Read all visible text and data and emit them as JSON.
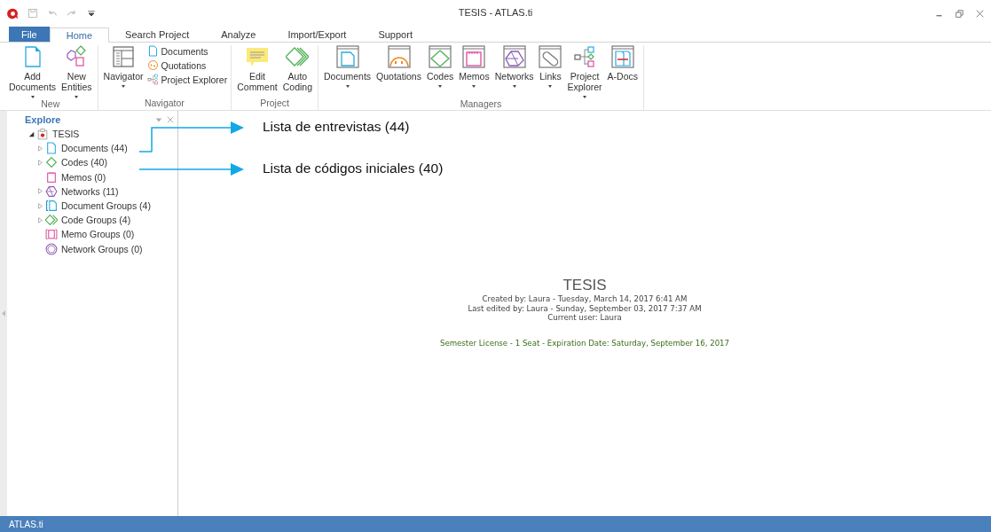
{
  "window": {
    "title": "TESIS - ATLAS.ti"
  },
  "tabs": [
    {
      "label": "File",
      "kind": "file",
      "selected": false
    },
    {
      "label": "Home",
      "kind": "tab",
      "selected": true
    },
    {
      "label": "Search Project",
      "kind": "tab",
      "selected": false
    },
    {
      "label": "Analyze",
      "kind": "tab",
      "selected": false
    },
    {
      "label": "Import/Export",
      "kind": "tab",
      "selected": false
    },
    {
      "label": "Support",
      "kind": "tab",
      "selected": false
    }
  ],
  "ribbon": {
    "groups": [
      {
        "label": "New",
        "buttons": [
          {
            "kind": "large",
            "lines": [
              "Add",
              "Documents"
            ],
            "dropdown": true
          },
          {
            "kind": "large",
            "lines": [
              "New",
              "Entities"
            ],
            "dropdown": true
          }
        ]
      },
      {
        "label": "Navigator",
        "buttons": [
          {
            "kind": "large",
            "lines": [
              "Navigator"
            ],
            "dropdown": true
          },
          {
            "kind": "small",
            "lines": [
              "Documents"
            ],
            "dropdown": false
          },
          {
            "kind": "small",
            "lines": [
              "Quotations"
            ],
            "dropdown": false
          },
          {
            "kind": "small",
            "lines": [
              "Project Explorer"
            ],
            "dropdown": false
          }
        ]
      },
      {
        "label": "Project",
        "buttons": [
          {
            "kind": "large",
            "lines": [
              "Edit",
              "Comment"
            ],
            "dropdown": false
          },
          {
            "kind": "large",
            "lines": [
              "Auto",
              "Coding"
            ],
            "dropdown": false
          }
        ]
      },
      {
        "label": "Managers",
        "buttons": [
          {
            "kind": "large",
            "lines": [
              "Documents"
            ],
            "dropdown": true
          },
          {
            "kind": "large",
            "lines": [
              "Quotations"
            ],
            "dropdown": false
          },
          {
            "kind": "large",
            "lines": [
              "Codes"
            ],
            "dropdown": true
          },
          {
            "kind": "large",
            "lines": [
              "Memos"
            ],
            "dropdown": true
          },
          {
            "kind": "large",
            "lines": [
              "Networks"
            ],
            "dropdown": true
          },
          {
            "kind": "large",
            "lines": [
              "Links"
            ],
            "dropdown": true
          },
          {
            "kind": "large",
            "lines": [
              "Project",
              "Explorer"
            ],
            "dropdown": true
          },
          {
            "kind": "large",
            "lines": [
              "A-Docs"
            ],
            "dropdown": false
          }
        ]
      }
    ]
  },
  "explore": {
    "title": "Explore",
    "tree": [
      {
        "label": "TESIS",
        "kind": "project",
        "expanded": true,
        "children": [
          {
            "label": "Documents (44)",
            "kind": "document",
            "expandable": true
          },
          {
            "label": "Codes (40)",
            "kind": "code",
            "expandable": true
          },
          {
            "label": "Memos (0)",
            "kind": "memo",
            "expandable": false
          },
          {
            "label": "Networks (11)",
            "kind": "network",
            "expandable": true
          },
          {
            "label": "Document Groups (4)",
            "kind": "doc-group",
            "expandable": true
          },
          {
            "label": "Code Groups (4)",
            "kind": "code-group",
            "expandable": true
          },
          {
            "label": "Memo Groups (0)",
            "kind": "memo-group",
            "expandable": false
          },
          {
            "label": "Network Groups (0)",
            "kind": "net-group",
            "expandable": false
          }
        ]
      }
    ]
  },
  "annotations": [
    {
      "text": "Lista de entrevistas (44)",
      "kind": "bracket"
    },
    {
      "text": "Lista de códigos iniciales (40)",
      "kind": "straight"
    }
  ],
  "project_info": {
    "title": "TESIS",
    "lines": [
      "Created by: Laura  - Tuesday, March 14, 2017 6:41 AM",
      "Last edited by: Laura  - Sunday, September 03, 2017 7:37 AM",
      "Current user: Laura"
    ],
    "license": "Semester License - 1 Seat - Expiration Date: Saturday, September 16, 2017"
  },
  "status_bar": {
    "text": "ATLAS.ti"
  }
}
